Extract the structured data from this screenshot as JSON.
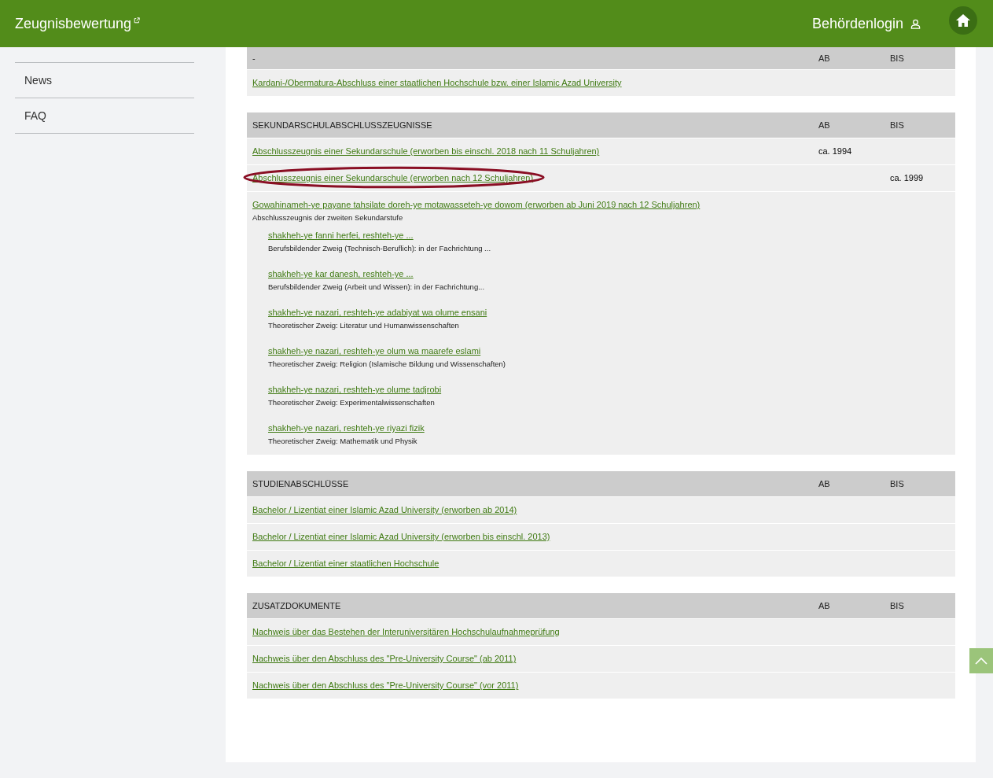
{
  "header": {
    "title": "Zeugnisbewertung",
    "login": "Behördenlogin"
  },
  "sidebar": {
    "items": [
      {
        "label": "News"
      },
      {
        "label": "FAQ"
      }
    ]
  },
  "tables": [
    {
      "heading": "-",
      "col_ab": "AB",
      "col_bis": "BIS",
      "rows": [
        {
          "label": "Kardani-/Obermatura-Abschluss einer staatlichen Hochschule bzw. einer Islamic Azad University",
          "highlighted": false
        }
      ]
    },
    {
      "heading": "SEKUNDARSCHULABSCHLUSSZEUGNISSE",
      "col_ab": "AB",
      "col_bis": "BIS",
      "rows": [
        {
          "label": "Abschlusszeugnis einer Sekundarschule (erworben bis einschl. 2018 nach 11 Schuljahren)",
          "ab": "ca. 1994",
          "highlighted": false
        },
        {
          "label": "Abschlusszeugnis einer Sekundarschule (erworben nach 12 Schuljahren)",
          "bis": "ca. 1999",
          "highlighted": true
        },
        {
          "label": "Gowahinameh-ye payane tahsilate doreh-ye motawasseteh-ye dowom (erworben ab Juni 2019 nach 12 Schuljahren)",
          "subtitle": "Abschlusszeugnis der zweiten Sekundarstufe",
          "highlighted": false,
          "children": [
            {
              "label": "shakheh-ye fanni herfei, reshteh-ye ...",
              "subtitle": "Berufsbildender Zweig (Technisch-Beruflich): in der Fachrichtung ..."
            },
            {
              "label": "shakheh-ye kar danesh, reshteh-ye ...",
              "subtitle": "Berufsbildender Zweig (Arbeit und Wissen): in der Fachrichtung..."
            },
            {
              "label": "shakheh-ye nazari, reshteh-ye adabiyat wa olume ensani",
              "subtitle": "Theoretischer Zweig: Literatur und Humanwissenschaften"
            },
            {
              "label": "shakheh-ye nazari, reshteh-ye olum wa maarefe eslami",
              "subtitle": "Theoretischer Zweig: Religion (Islamische Bildung und Wissenschaften)"
            },
            {
              "label": "shakheh-ye nazari, reshteh-ye olume tadjrobi",
              "subtitle": "Theoretischer Zweig: Experimentalwissenschaften"
            },
            {
              "label": "shakheh-ye nazari, reshteh-ye riyazi fizik",
              "subtitle": "Theoretischer Zweig: Mathematik und Physik"
            }
          ]
        }
      ]
    },
    {
      "heading": "STUDIENABSCHLÜSSE",
      "col_ab": "AB",
      "col_bis": "BIS",
      "rows": [
        {
          "label": "Bachelor / Lizentiat einer Islamic Azad University (erworben ab 2014)",
          "highlighted": false
        },
        {
          "label": "Bachelor / Lizentiat einer Islamic Azad University (erworben bis einschl. 2013)",
          "highlighted": false
        },
        {
          "label": "Bachelor / Lizentiat einer staatlichen Hochschule",
          "highlighted": false
        }
      ]
    },
    {
      "heading": "ZUSATZDOKUMENTE",
      "col_ab": "AB",
      "col_bis": "BIS",
      "rows": [
        {
          "label": "Nachweis über das Bestehen der Interuniversitären Hochschulaufnahmeprüfung",
          "highlighted": false
        },
        {
          "label": "Nachweis über den Abschluss des \"Pre-University Course\" (ab 2011)",
          "highlighted": false
        },
        {
          "label": "Nachweis über den Abschluss des \"Pre-University Course\" (vor 2011)",
          "highlighted": false
        }
      ]
    }
  ]
}
